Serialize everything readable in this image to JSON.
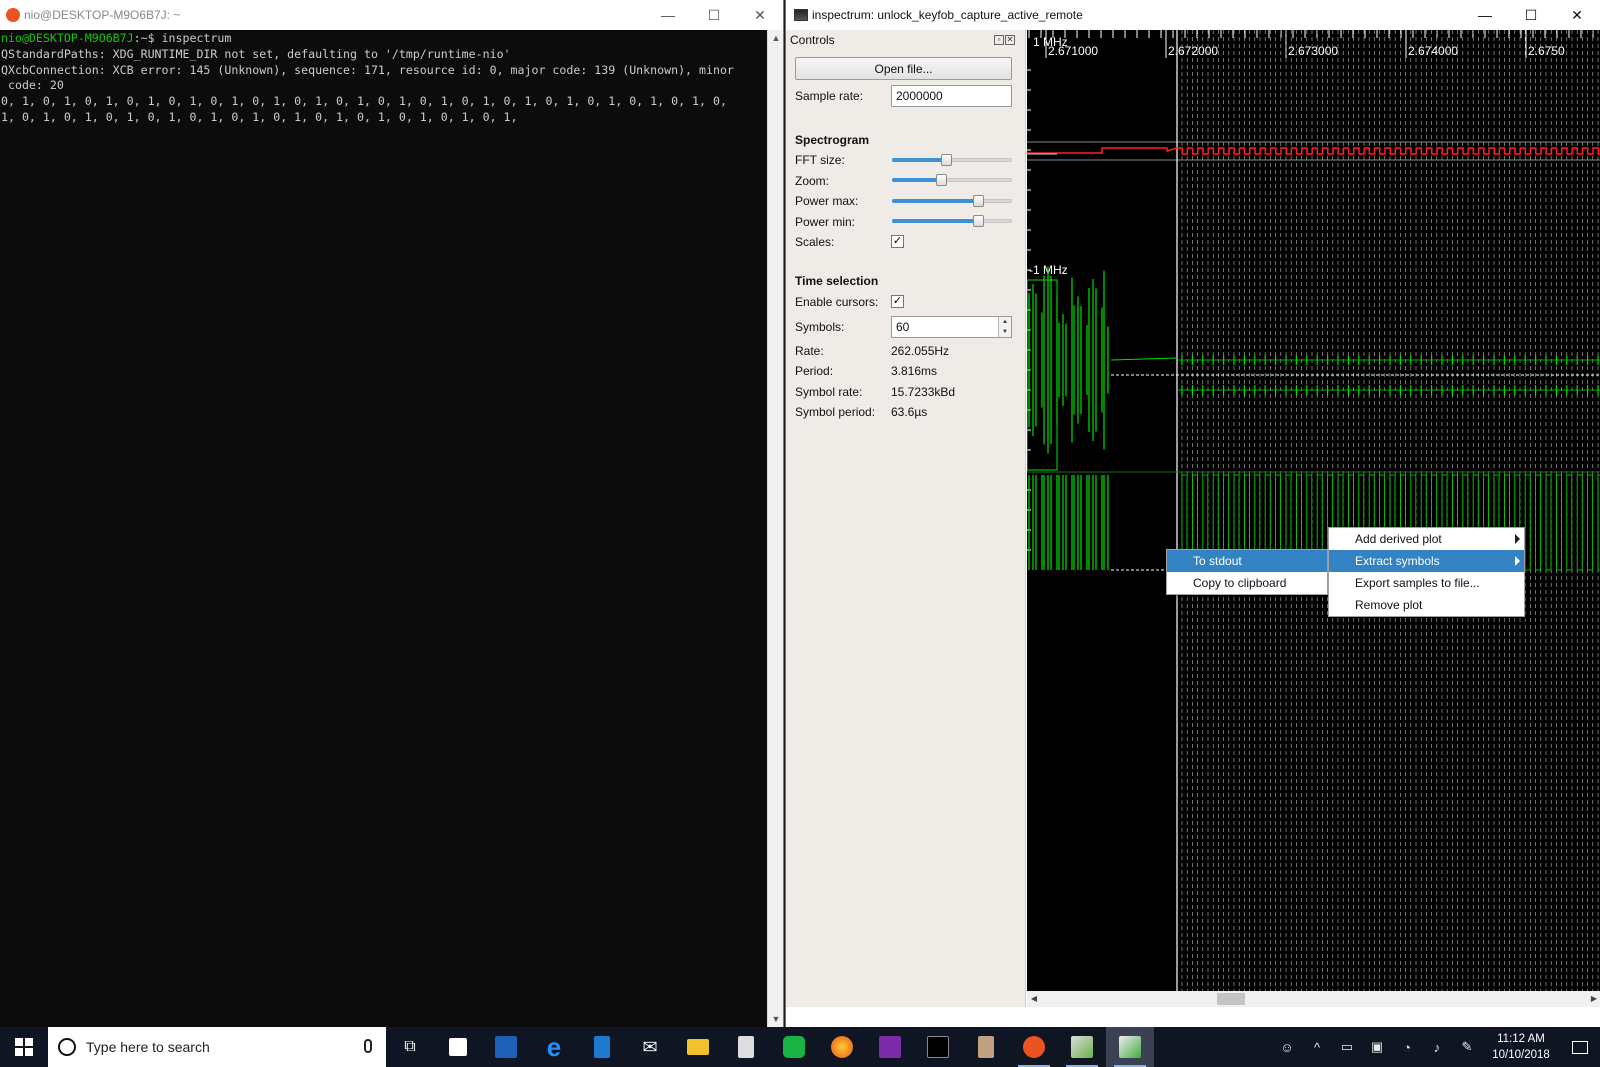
{
  "terminal": {
    "title": "nio@DESKTOP-M9O6B7J: ~",
    "prompt": "nio@DESKTOP-M9O6B7J",
    "prompt_suffix": ":~$ inspectrum",
    "lines": [
      "QStandardPaths: XDG_RUNTIME_DIR not set, defaulting to '/tmp/runtime-nio'",
      "QXcbConnection: XCB error: 145 (Unknown), sequence: 171, resource id: 0, major code: 139 (Unknown), minor",
      " code: 20",
      "0, 1, 0, 1, 0, 1, 0, 1, 0, 1, 0, 1, 0, 1, 0, 1, 0, 1, 0, 1, 0, 1, 0, 1, 0, 1, 0, 1, 0, 1, 0, 1, 0, 1, 0,",
      "1, 0, 1, 0, 1, 0, 1, 0, 1, 0, 1, 0, 1, 0, 1, 0, 1, 0, 1, 0, 1, 0, 1, 0, 1,"
    ],
    "minimize": "—",
    "maximize": "☐",
    "close": "✕"
  },
  "inspectrum": {
    "title": "inspectrum: unlock_keyfob_capture_active_remote",
    "controls_header": "Controls",
    "open_file": "Open file...",
    "sample_rate_label": "Sample rate:",
    "sample_rate_value": "2000000",
    "spectrogram_header": "Spectrogram",
    "fft_label": "FFT size:",
    "zoom_label": "Zoom:",
    "power_max_label": "Power max:",
    "power_min_label": "Power min:",
    "scales_label": "Scales:",
    "scales_checked": "✓",
    "sliders": {
      "fft": 0.45,
      "zoom": 0.41,
      "power_max": 0.72,
      "power_min": 0.72
    },
    "time_header": "Time selection",
    "cursors_label": "Enable cursors:",
    "cursors_checked": "✓",
    "symbols_label": "Symbols:",
    "symbols_value": "60",
    "rate_label": "Rate:",
    "rate_value": "262.055Hz",
    "period_label": "Period:",
    "period_value": "3.816ms",
    "symbol_rate_label": "Symbol rate:",
    "symbol_rate_value": "15.7233kBd",
    "symbol_period_label": "Symbol period:",
    "symbol_period_value": "63.6µs",
    "freq_top": "1 MHz",
    "freq_low": "-1 MHz",
    "time_ticks": [
      "2.671000",
      "2.672000",
      "2.673000",
      "2.674000",
      "2.6750"
    ],
    "colors": {
      "trace": "#00e000",
      "cursor": "#ffffff",
      "red_trace": "#ff2020"
    }
  },
  "context_menu": {
    "items": [
      "Add derived plot",
      "Extract symbols",
      "Export samples to file...",
      "Remove plot"
    ],
    "selected": "Extract symbols"
  },
  "submenu": {
    "items": [
      "To stdout",
      "Copy to clipboard"
    ],
    "selected": "To stdout"
  },
  "taskbar": {
    "search_placeholder": "Type here to search",
    "time": "11:12 AM",
    "date": "10/10/2018",
    "apps": [
      "task-view",
      "store",
      "stocks",
      "edge",
      "vscode",
      "mail",
      "explorer",
      "calculator",
      "spotify-like",
      "firefox",
      "onenote",
      "terminal",
      "inspectrum-util",
      "ubuntu",
      "image-app",
      "inspectrum"
    ]
  }
}
